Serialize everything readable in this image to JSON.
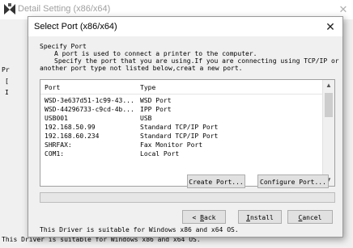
{
  "background_window": {
    "title": "Detail Setting (x86/x64)",
    "fragments": [
      "I",
      "Pr",
      "[",
      "I"
    ],
    "footer_text": "This Driver is suitable for Windows x86 and x64 OS."
  },
  "dialog": {
    "title": "Select Port (x86/x64)",
    "intro": {
      "heading": "Specify Port",
      "line1": "A port is used to connect a printer to the computer.",
      "line2": "Specify the port that you are using.If you are connecting using TCP/IP or",
      "line3": "another port type not listed below,creat a new port."
    },
    "list": {
      "columns": [
        "Port",
        "Type"
      ],
      "rows": [
        {
          "port": "WSD-3e637d51-1c99-43...",
          "type": "WSD Port"
        },
        {
          "port": "WSD-44296733-c9cd-4b...",
          "type": "IPP Port"
        },
        {
          "port": "USB001",
          "type": "USB"
        },
        {
          "port": "192.168.50.99",
          "type": "Standard TCP/IP Port"
        },
        {
          "port": "192.168.60.234",
          "type": "Standard TCP/IP Port"
        },
        {
          "port": "SHRFAX:",
          "type": "Fax Monitor Port"
        },
        {
          "port": "COM1:",
          "type": "Local Port"
        }
      ]
    },
    "buttons": {
      "create_port": "Create Port...",
      "configure_port": "Configure Port...",
      "back_prefix": "< ",
      "back_key": "B",
      "back_rest": "ack",
      "install_key": "I",
      "install_rest": "nstall",
      "cancel_key": "C",
      "cancel_rest": "ancel"
    },
    "progress_percent": 0,
    "driver_note": "This Driver is suitable for Windows x86 and x64 OS."
  },
  "colors": {
    "window_bg": "#f0f0f0",
    "titlebar_bg": "#ffffff",
    "button_bg": "#e1e1e1",
    "button_border": "#adadad"
  },
  "icons": {
    "app": "printer-app-icon",
    "close": "close-icon",
    "scroll_up": "chevron-up-icon",
    "scroll_down": "chevron-down-icon"
  }
}
